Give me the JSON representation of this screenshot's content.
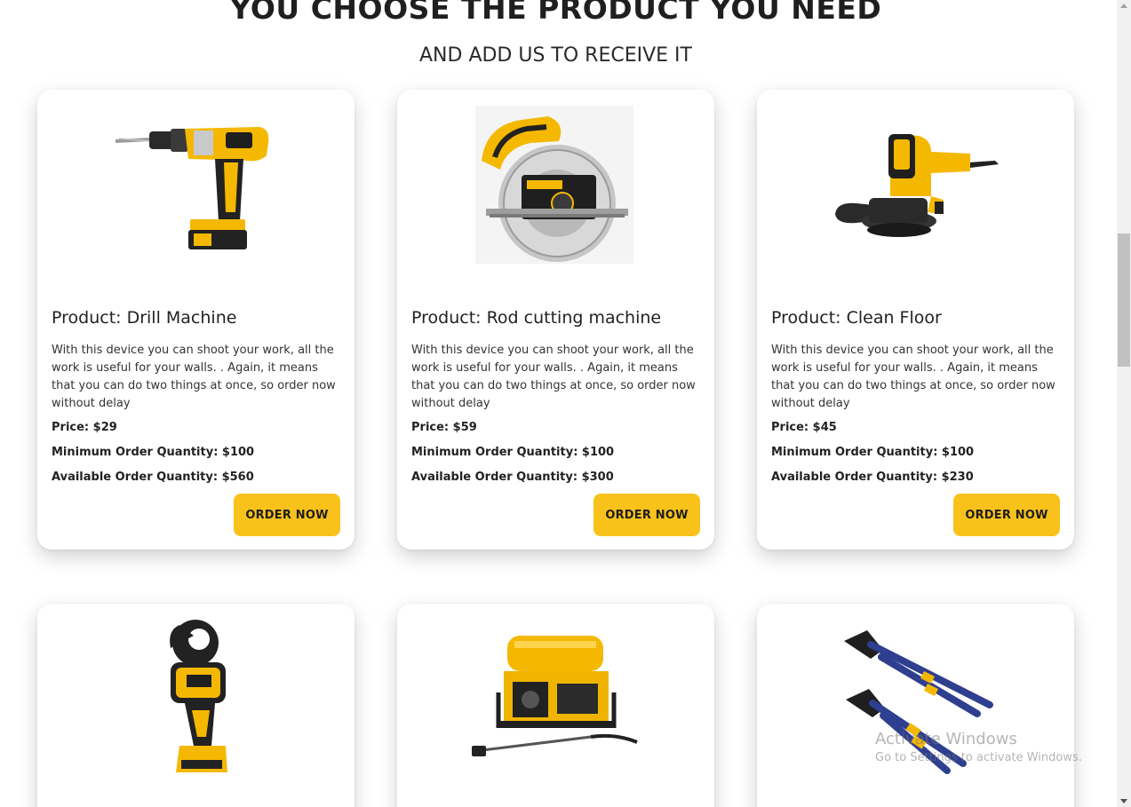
{
  "header": {
    "title": "YOU CHOOSE THE PRODUCT YOU NEED",
    "subtitle": "AND ADD US TO RECEIVE IT"
  },
  "products": [
    {
      "image": "cordless-drill-image",
      "title": "Product: Drill Machine",
      "description": "With this device you can shoot your work, all the work is useful for your walls. . Again, it means that you can do two things at once, so order now without delay",
      "price": "Price: $29",
      "min_qty": "Minimum Order Quantity: $100",
      "avail_qty": "Available Order Quantity: $560",
      "button_label": "ORDER NOW"
    },
    {
      "image": "circular-saw-image",
      "title": "Product: Rod cutting machine",
      "description": "With this device you can shoot your work, all the work is useful for your walls. . Again, it means that you can do two things at once, so order now without delay",
      "price": "Price: $59",
      "min_qty": "Minimum Order Quantity: $100",
      "avail_qty": "Available Order Quantity: $300",
      "button_label": "ORDER NOW"
    },
    {
      "image": "floor-sander-image",
      "title": "Product: Clean Floor",
      "description": "With this device you can shoot your work, all the work is useful for your walls. . Again, it means that you can do two things at once, so order now without delay",
      "price": "Price: $45",
      "min_qty": "Minimum Order Quantity: $100",
      "avail_qty": "Available Order Quantity: $230",
      "button_label": "ORDER NOW"
    },
    {
      "image": "cable-cutter-image"
    },
    {
      "image": "pressure-washer-image"
    },
    {
      "image": "pliers-image"
    }
  ],
  "watermark": {
    "title": "Activate Windows",
    "subtitle": "Go to Settings to activate Windows."
  },
  "colors": {
    "accent": "#f9c21b",
    "tool_yellow": "#f5b800",
    "tool_black": "#222222"
  }
}
